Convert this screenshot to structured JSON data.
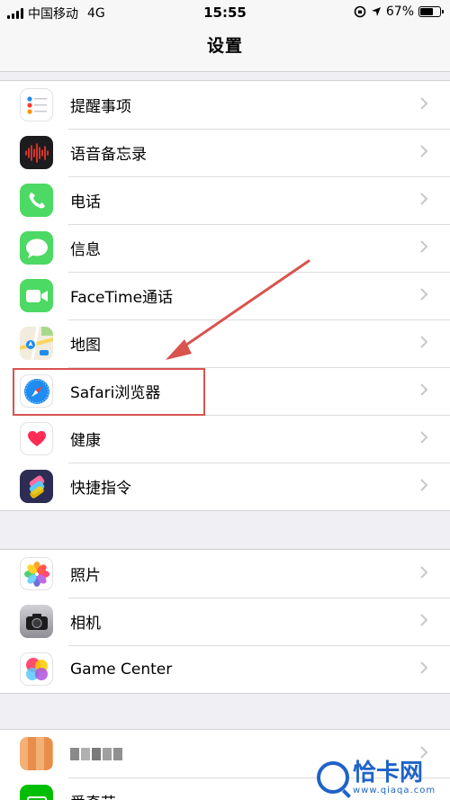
{
  "status_bar": {
    "carrier": "中国移动",
    "network": "4G",
    "time": "15:55",
    "battery": "67%",
    "battery_level": 0.67
  },
  "nav": {
    "title": "设置"
  },
  "group1": [
    {
      "label": "提醒事项",
      "icon": "reminders-icon",
      "color": "#ffffff"
    },
    {
      "label": "语音备忘录",
      "icon": "voice-memos-icon",
      "color": "#1c1c1e"
    },
    {
      "label": "电话",
      "icon": "phone-icon",
      "color": "#4cd964"
    },
    {
      "label": "信息",
      "icon": "messages-icon",
      "color": "#4cd964"
    },
    {
      "label": "FaceTime通话",
      "icon": "facetime-icon",
      "color": "#4cd964"
    },
    {
      "label": "地图",
      "icon": "maps-icon",
      "color": "#e9e4d8"
    },
    {
      "label": "Safari浏览器",
      "icon": "safari-icon",
      "color": "#1e8cf0"
    },
    {
      "label": "健康",
      "icon": "health-icon",
      "color": "#ffffff"
    },
    {
      "label": "快捷指令",
      "icon": "shortcuts-icon",
      "color": "#2c2c54"
    }
  ],
  "group2": [
    {
      "label": "照片",
      "icon": "photos-icon",
      "color": "#ffffff"
    },
    {
      "label": "相机",
      "icon": "camera-icon",
      "color": "#8e8e93"
    },
    {
      "label": "Game Center",
      "icon": "game-center-icon",
      "color": "#ffffff"
    }
  ],
  "group3": [
    {
      "label": "",
      "icon": "blurred-app-icon",
      "color": "#f0a060"
    },
    {
      "label": "爱奇艺",
      "icon": "iqiyi-icon",
      "color": "#00be06"
    }
  ],
  "annotation": {
    "color": "#d9534f"
  },
  "watermark": {
    "name": "恰卡网",
    "url": "www.qiaqa.com",
    "color": "#1e63c8"
  }
}
